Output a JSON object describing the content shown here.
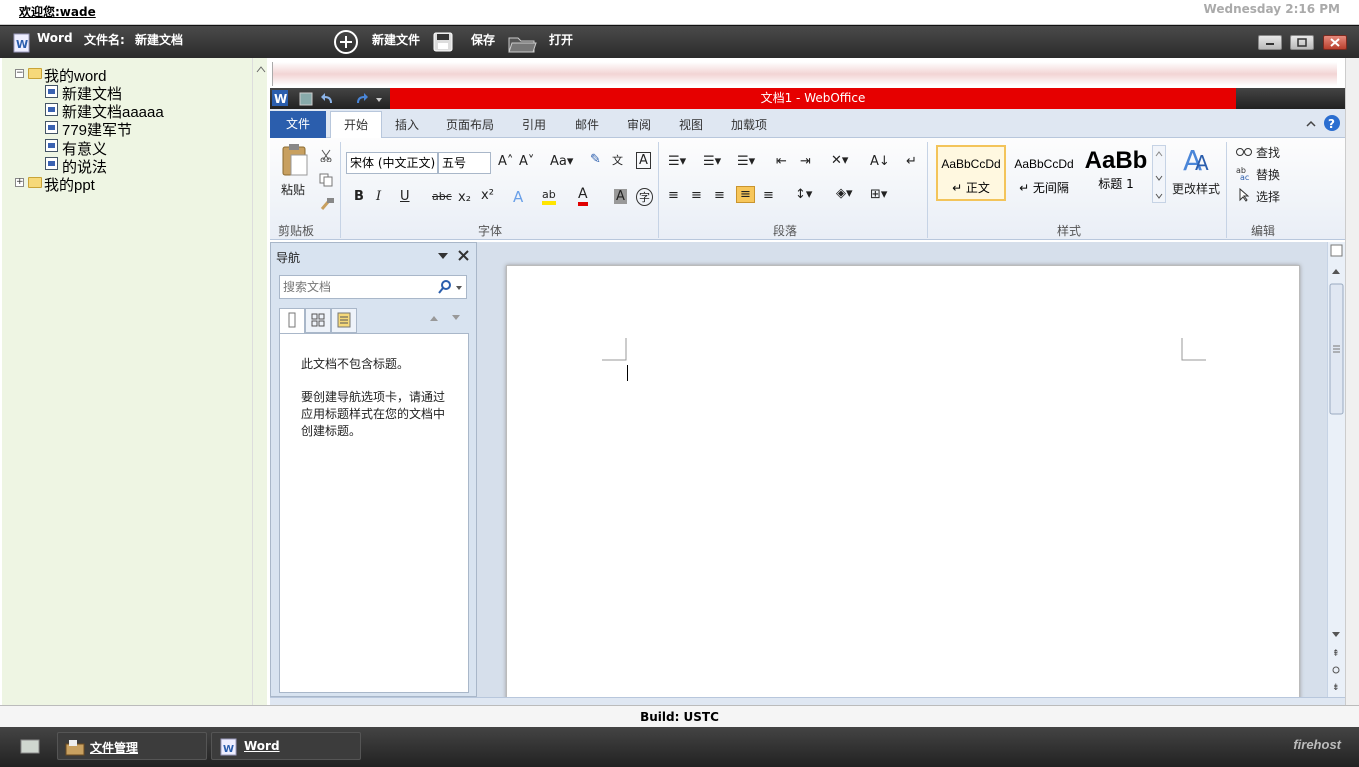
{
  "top": {
    "welcome": "欢迎您:wade",
    "datetime": "Wednesday 2:16 PM"
  },
  "header": {
    "app": "Word",
    "filename_label": "文件名:",
    "filename": "新建文档",
    "new_label": "新建文件",
    "save_label": "保存",
    "open_label": "打开"
  },
  "tree": {
    "root1": "我的word",
    "items": [
      "新建文档",
      "新建文档aaaaa",
      "779建军节",
      "有意义",
      "的说法"
    ],
    "root2": "我的ppt"
  },
  "office": {
    "title": "文档1 - WebOffice",
    "tabs": [
      "文件",
      "开始",
      "插入",
      "页面布局",
      "引用",
      "邮件",
      "审阅",
      "视图",
      "加载项"
    ],
    "ribbon": {
      "paste": "粘贴",
      "clipboard": "剪贴板",
      "font_name": "宋体 (中文正文)",
      "font_size": "五号",
      "font_group": "字体",
      "paragraph_group": "段落",
      "styles_group": "样式",
      "edit_group": "编辑",
      "styles": [
        {
          "preview": "AaBbCcDd",
          "name": "↵ 正文"
        },
        {
          "preview": "AaBbCcDd",
          "name": "↵ 无间隔"
        },
        {
          "preview": "AaBb",
          "name": "标题 1"
        }
      ],
      "change_styles": "更改样式",
      "find": "查找",
      "replace": "替换",
      "select": "选择"
    },
    "nav": {
      "title": "导航",
      "search_placeholder": "搜索文档",
      "msg1": "此文档不包含标题。",
      "msg2": "要创建导航选项卡，请通过应用标题样式在您的文档中创建标题。"
    }
  },
  "build": "Build: USTC",
  "taskbar": {
    "items": [
      "文件管理",
      "Word"
    ],
    "brand": "firehost"
  }
}
